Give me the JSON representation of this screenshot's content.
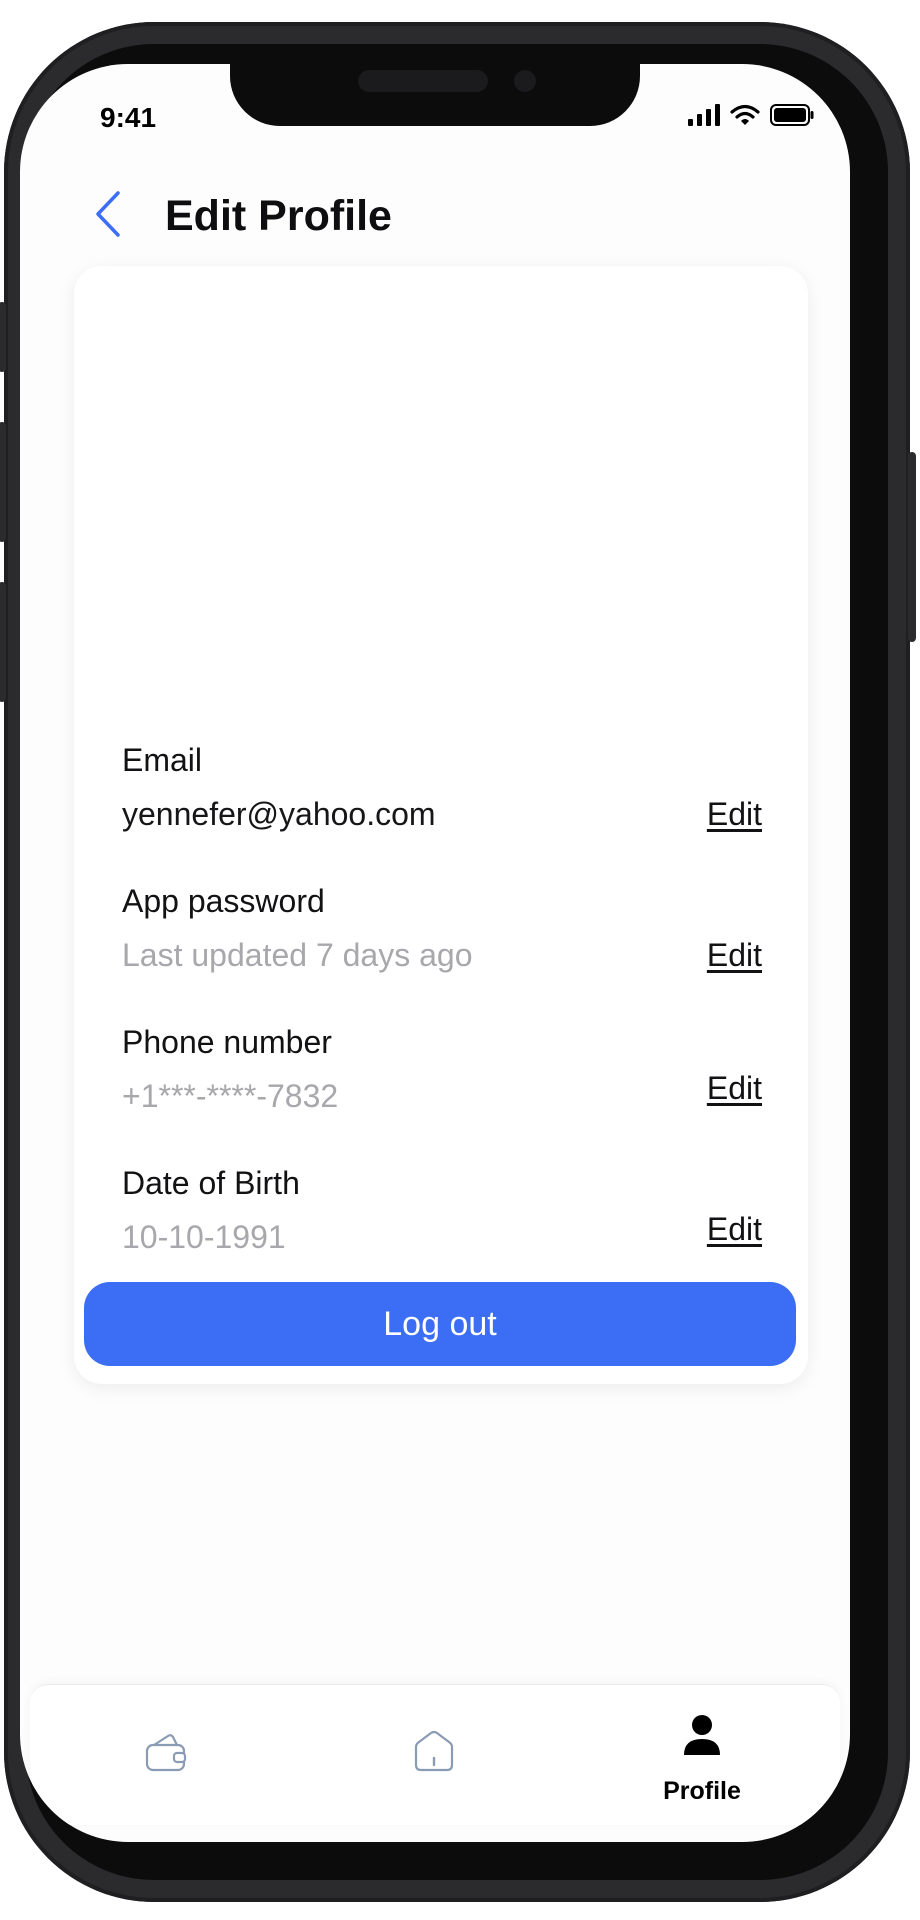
{
  "status_bar": {
    "time": "9:41"
  },
  "header": {
    "title": "Edit Profile",
    "back_icon": "chevron-left-icon"
  },
  "fields": [
    {
      "label": "Email",
      "value": "yennefer@yahoo.com",
      "value_style": "dark",
      "action": "Edit"
    },
    {
      "label": "App password",
      "value": "Last updated 7 days ago",
      "value_style": "muted",
      "action": "Edit"
    },
    {
      "label": "Phone number",
      "value": "+1***-****-7832",
      "value_style": "muted",
      "action": "Edit"
    },
    {
      "label": "Date of Birth",
      "value": "10-10-1991",
      "value_style": "muted",
      "action": "Edit"
    }
  ],
  "logout_label": "Log out",
  "bottom_nav": {
    "items": [
      {
        "icon": "wallet-icon",
        "label": ""
      },
      {
        "icon": "home-icon",
        "label": ""
      },
      {
        "icon": "profile-icon",
        "label": "Profile",
        "active": true
      }
    ]
  },
  "colors": {
    "accent": "#3B6EF5",
    "text_primary": "#121214",
    "text_muted": "#A7A7AC",
    "inactive_icon": "#8A9BB4"
  }
}
